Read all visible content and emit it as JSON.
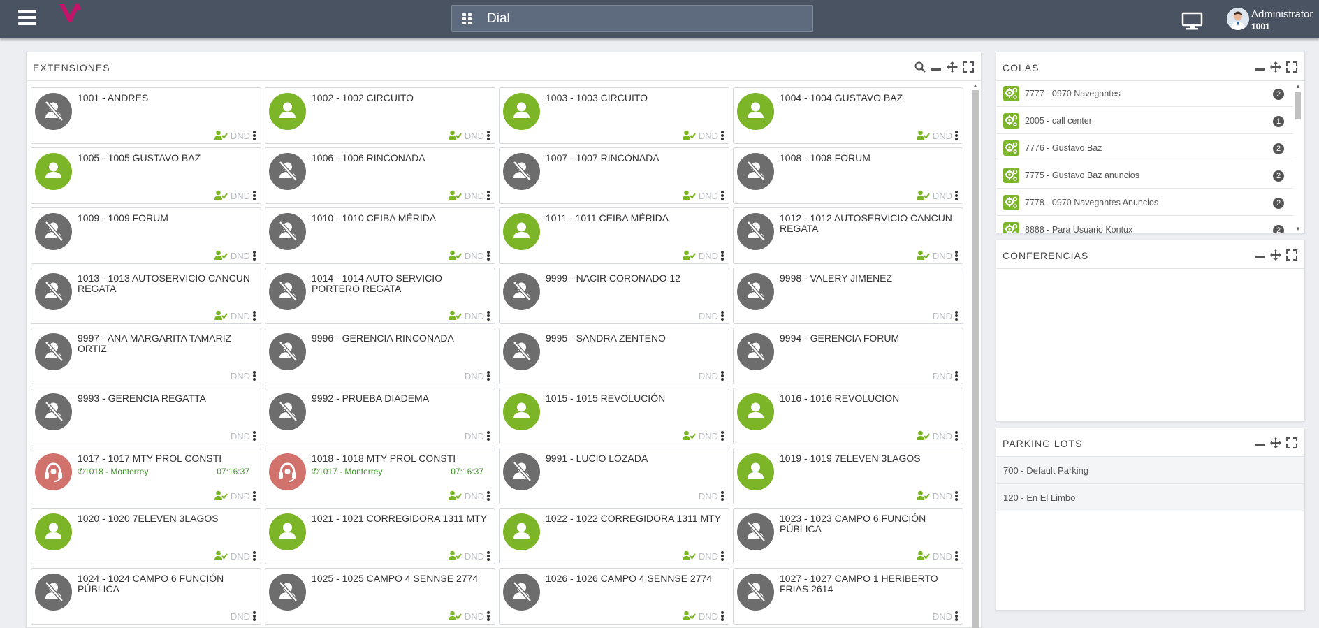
{
  "topbar": {
    "dial_label": "Dial",
    "user_name": "Administrator",
    "user_ext": "1001",
    "icons": [
      "menu-icon",
      "logo",
      "grid-icon",
      "monitor-icon",
      "user-avatar"
    ]
  },
  "extensions": {
    "title": "EXTENSIONES",
    "dnd_label": "DND",
    "colors": {
      "available": "#7cb527",
      "unavailable": "#6d6d6d",
      "in_call": "#d2726c"
    },
    "items": [
      {
        "name": "1001 - ANDRES",
        "status": "unavailable",
        "user_icon": true
      },
      {
        "name": "1002 - 1002 CIRCUITO",
        "status": "available",
        "user_icon": true
      },
      {
        "name": "1003 - 1003 CIRCUITO",
        "status": "available",
        "user_icon": true
      },
      {
        "name": "1004 - 1004 GUSTAVO BAZ",
        "status": "available",
        "user_icon": true
      },
      {
        "name": "1005 - 1005 GUSTAVO BAZ",
        "status": "available",
        "user_icon": true
      },
      {
        "name": "1006 - 1006 RINCONADA",
        "status": "unavailable",
        "user_icon": true
      },
      {
        "name": "1007 - 1007 RINCONADA",
        "status": "unavailable",
        "user_icon": true
      },
      {
        "name": "1008 - 1008 FORUM",
        "status": "unavailable",
        "user_icon": true
      },
      {
        "name": "1009 - 1009 FORUM",
        "status": "unavailable",
        "user_icon": true
      },
      {
        "name": "1010 - 1010 CEIBA MÉRIDA",
        "status": "unavailable",
        "user_icon": true
      },
      {
        "name": "1011 - 1011 CEIBA MÉRIDA",
        "status": "available",
        "user_icon": true
      },
      {
        "name": "1012 - 1012 AUTOSERVICIO CANCUN REGATA",
        "status": "unavailable",
        "user_icon": true
      },
      {
        "name": "1013 - 1013 AUTOSERVICIO CANCUN REGATA",
        "status": "unavailable",
        "user_icon": true
      },
      {
        "name": "1014 - 1014 AUTO SERVICIO PORTERO REGATA",
        "status": "unavailable",
        "user_icon": true
      },
      {
        "name": "9999 - NACIR CORONADO 12",
        "status": "unavailable",
        "user_icon": false
      },
      {
        "name": "9998 - VALERY JIMENEZ",
        "status": "unavailable",
        "user_icon": false
      },
      {
        "name": "9997 - ANA MARGARITA TAMARIZ ORTIZ",
        "status": "unavailable",
        "user_icon": false
      },
      {
        "name": "9996 - GERENCIA RINCONADA",
        "status": "unavailable",
        "user_icon": false
      },
      {
        "name": "9995 - SANDRA ZENTENO",
        "status": "unavailable",
        "user_icon": false
      },
      {
        "name": "9994 - GERENCIA FORUM",
        "status": "unavailable",
        "user_icon": false
      },
      {
        "name": "9993 - GERENCIA REGATTA",
        "status": "unavailable",
        "user_icon": false
      },
      {
        "name": "9992 - PRUEBA DIADEMA",
        "status": "unavailable",
        "user_icon": false
      },
      {
        "name": "1015 - 1015 REVOLUCIÓN",
        "status": "available",
        "user_icon": true
      },
      {
        "name": "1016 - 1016 REVOLUCION",
        "status": "available",
        "user_icon": true
      },
      {
        "name": "1017 - 1017 MTY PROL CONSTI",
        "status": "in_call",
        "user_icon": true,
        "call_peer": "1018 - Monterrey",
        "call_time": "07:16:37"
      },
      {
        "name": "1018 - 1018 MTY PROL CONSTI",
        "status": "in_call",
        "user_icon": true,
        "call_peer": "1017 - Monterrey",
        "call_time": "07:16:37"
      },
      {
        "name": "9991 - LUCIO LOZADA",
        "status": "unavailable",
        "user_icon": false
      },
      {
        "name": "1019 - 1019 7ELEVEN 3LAGOS",
        "status": "available",
        "user_icon": true
      },
      {
        "name": "1020 - 1020 7ELEVEN 3LAGOS",
        "status": "available",
        "user_icon": true
      },
      {
        "name": "1021 - 1021 CORREGIDORA 1311 MTY",
        "status": "available",
        "user_icon": true
      },
      {
        "name": "1022 - 1022 CORREGIDORA 1311 MTY",
        "status": "available",
        "user_icon": true
      },
      {
        "name": "1023 - 1023 CAMPO 6 FUNCIÓN PÚBLICA",
        "status": "unavailable",
        "user_icon": true
      },
      {
        "name": "1024 - 1024 CAMPO 6 FUNCIÓN PÚBLICA",
        "status": "unavailable",
        "user_icon": false
      },
      {
        "name": "1025 - 1025 CAMPO 4 SENNSE 2774",
        "status": "unavailable",
        "user_icon": true
      },
      {
        "name": "1026 - 1026 CAMPO 4 SENNSE 2774",
        "status": "unavailable",
        "user_icon": true
      },
      {
        "name": "1027 - 1027 CAMPO 1 HERIBERTO FRIAS 2614",
        "status": "unavailable",
        "user_icon": false
      }
    ]
  },
  "colas": {
    "title": "COLAS",
    "items": [
      {
        "name": "7777 - 0970 Navegantes",
        "count": "2"
      },
      {
        "name": "2005 - call center",
        "count": "1"
      },
      {
        "name": "7776 - Gustavo Baz",
        "count": "2"
      },
      {
        "name": "7775 - Gustavo Baz anuncios",
        "count": "2"
      },
      {
        "name": "7778 - 0970 Navegantes Anuncios",
        "count": "2"
      },
      {
        "name": "8888 - Para Usuario Kontux",
        "count": "2"
      }
    ]
  },
  "conferencias": {
    "title": "CONFERENCIAS"
  },
  "parking": {
    "title": "PARKING LOTS",
    "items": [
      {
        "name": "700 - Default Parking"
      },
      {
        "name": "120 - En El Limbo"
      }
    ]
  }
}
